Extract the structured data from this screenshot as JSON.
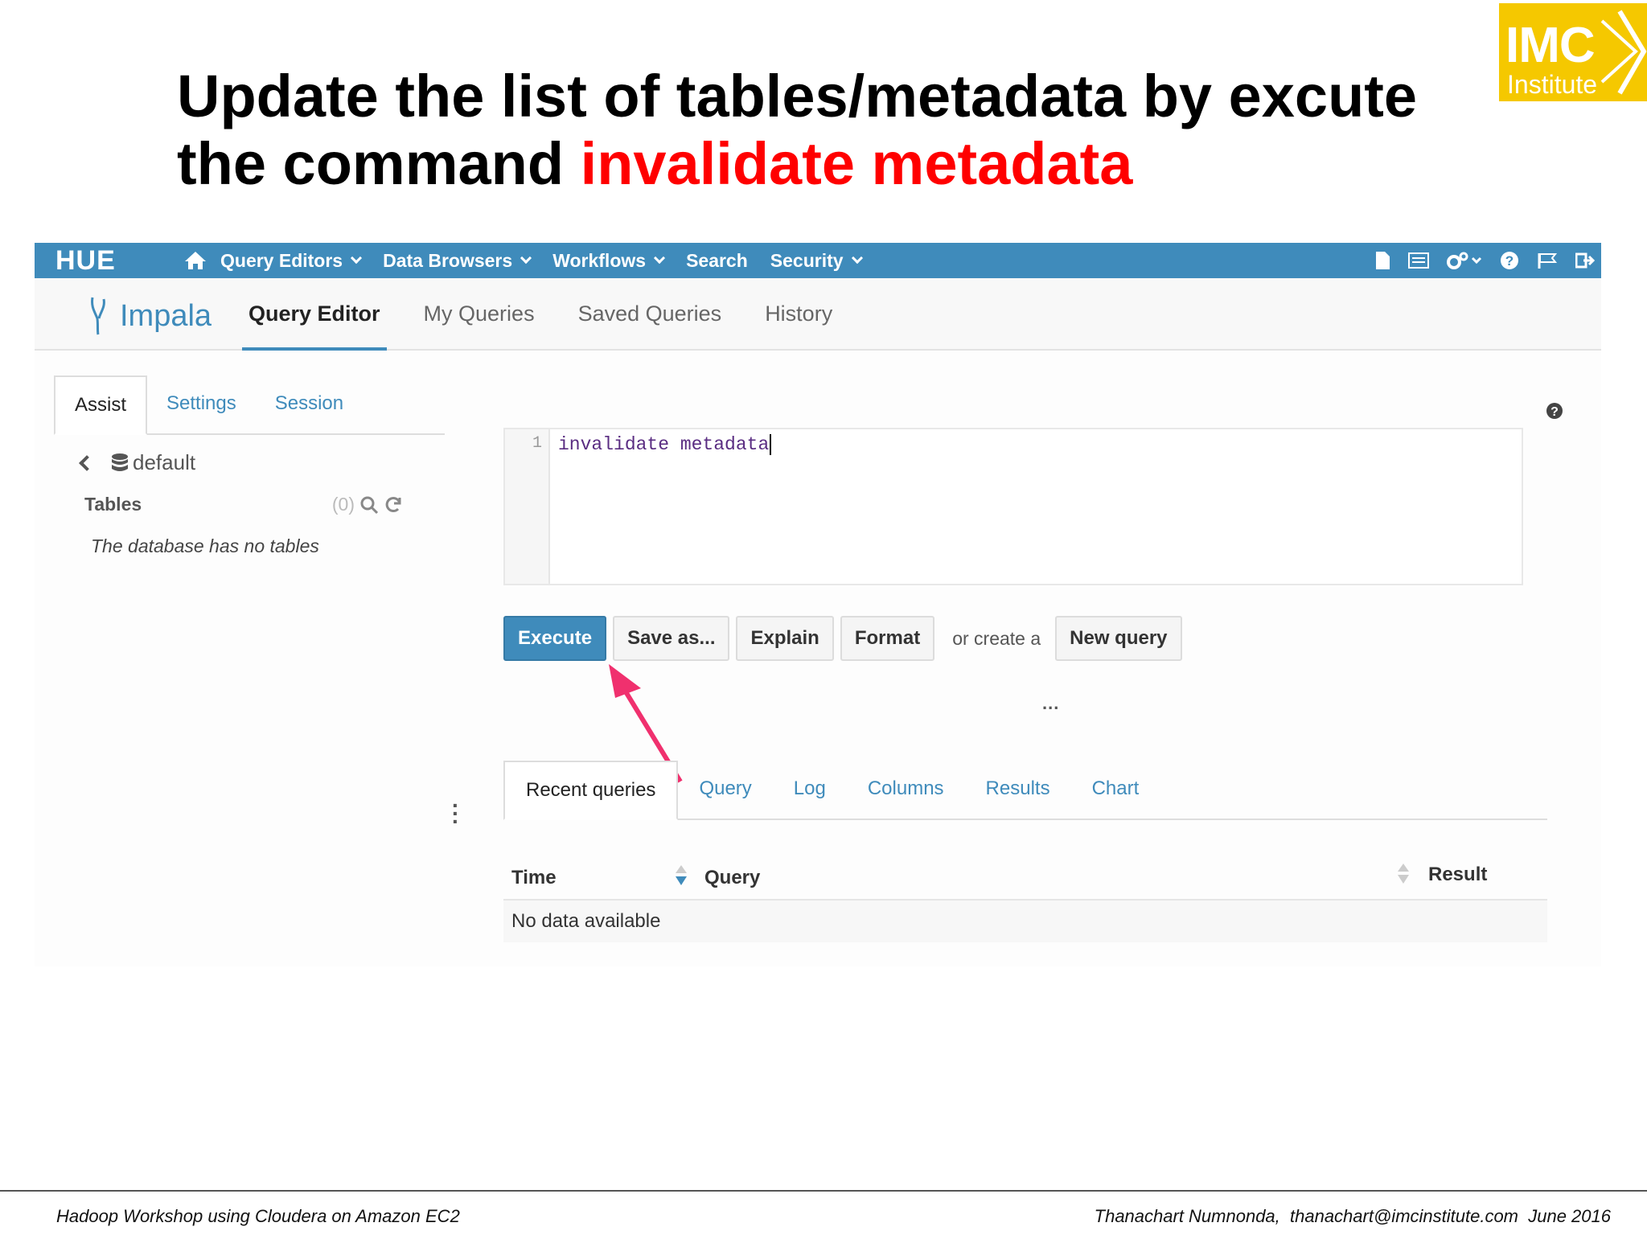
{
  "slide": {
    "title_part1": "Update the list of tables/metadata by excute",
    "title_part2": "the command ",
    "title_highlight": "invalidate metadata"
  },
  "logo": {
    "brand": "IMC",
    "sub": "Institute"
  },
  "hue": {
    "logo_text": "HUE",
    "topnav": [
      {
        "label": "Query Editors",
        "dropdown": true
      },
      {
        "label": "Data Browsers",
        "dropdown": true
      },
      {
        "label": "Workflows",
        "dropdown": true
      },
      {
        "label": "Search",
        "dropdown": false
      },
      {
        "label": "Security",
        "dropdown": true
      }
    ],
    "topright_icons": [
      "file-icon",
      "list-icon",
      "settings-icon",
      "help-icon",
      "flag-icon",
      "logout-icon"
    ],
    "app_name": "Impala",
    "subnav": [
      "Query Editor",
      "My Queries",
      "Saved Queries",
      "History"
    ],
    "active_subnav": "Query Editor"
  },
  "assist": {
    "tabs": [
      "Assist",
      "Settings",
      "Session"
    ],
    "database": "default",
    "tables_label": "Tables",
    "tables_count": "(0)",
    "empty_message": "The database has no tables"
  },
  "editor": {
    "line_number": "1",
    "code": "invalidate metadata"
  },
  "actions": {
    "execute": "Execute",
    "save_as": "Save as...",
    "explain": "Explain",
    "format": "Format",
    "or_create": "or create a",
    "new_query": "New query",
    "more": "..."
  },
  "results": {
    "tabs": [
      "Recent queries",
      "Query",
      "Log",
      "Columns",
      "Results",
      "Chart"
    ],
    "columns": [
      "Time",
      "Query",
      "Result"
    ],
    "empty": "No data available"
  },
  "footer": {
    "left": "Hadoop Workshop using Cloudera on Amazon EC2",
    "right": "Thanachart Numnonda,  thanachart@imcinstitute.com  June 2016"
  },
  "colors": {
    "hue_blue": "#3f8bbb",
    "highlight_red": "#ff0000",
    "logo_yellow": "#f5c800",
    "arrow_pink": "#f0306e"
  }
}
